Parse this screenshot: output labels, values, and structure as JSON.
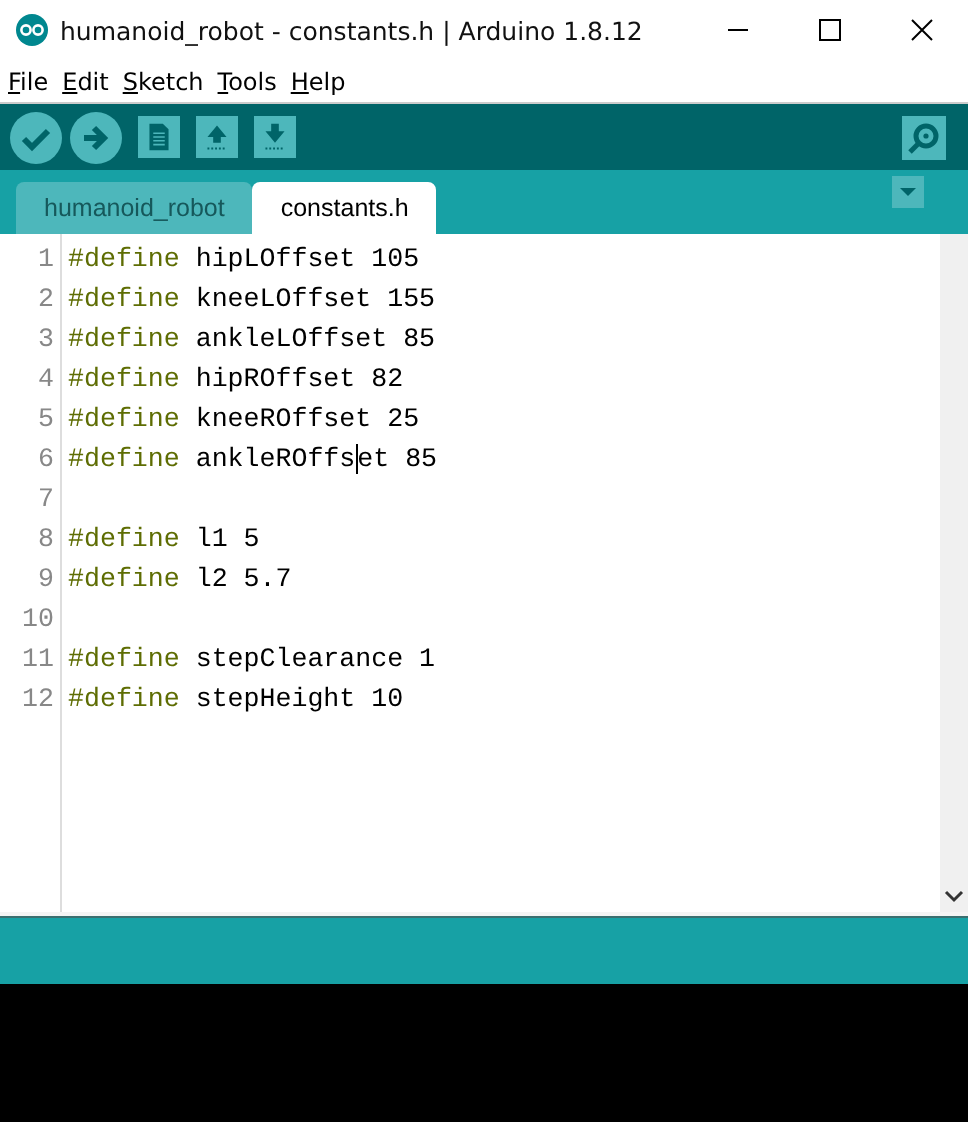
{
  "window": {
    "title": "humanoid_robot - constants.h | Arduino 1.8.12"
  },
  "menu": [
    {
      "label": "File"
    },
    {
      "label": "Edit"
    },
    {
      "label": "Sketch"
    },
    {
      "label": "Tools"
    },
    {
      "label": "Help"
    }
  ],
  "toolbar": [
    {
      "kind": "verify"
    },
    {
      "kind": "upload"
    },
    {
      "kind": "new"
    },
    {
      "kind": "open"
    },
    {
      "kind": "save"
    }
  ],
  "tabs": [
    {
      "label": "humanoid_robot",
      "selected": false
    },
    {
      "label": "constants.h",
      "selected": true
    }
  ],
  "editor": {
    "lines": [
      {
        "number": "1",
        "keyword": "#define",
        "text": "hipLOffset 105"
      },
      {
        "number": "2",
        "keyword": "#define",
        "text": "kneeLOffset 155"
      },
      {
        "number": "3",
        "keyword": "#define",
        "text": "ankleLOffset 85"
      },
      {
        "number": "4",
        "keyword": "#define",
        "text": "hipROffset 82"
      },
      {
        "number": "5",
        "keyword": "#define",
        "text": "kneeROffset 25"
      },
      {
        "number": "6",
        "keyword": "#define",
        "text": "ankleROffs",
        "after_cursor": "et 85"
      },
      {
        "number": "7"
      },
      {
        "number": "8",
        "keyword": "#define",
        "text": "l1 5"
      },
      {
        "number": "9",
        "keyword": "#define",
        "text": "l2 5.7"
      },
      {
        "number": "10"
      },
      {
        "number": "11",
        "keyword": "#define",
        "text": "stepClearance 1"
      },
      {
        "number": "12",
        "keyword": "#define",
        "text": "stepHeight 10"
      }
    ]
  }
}
